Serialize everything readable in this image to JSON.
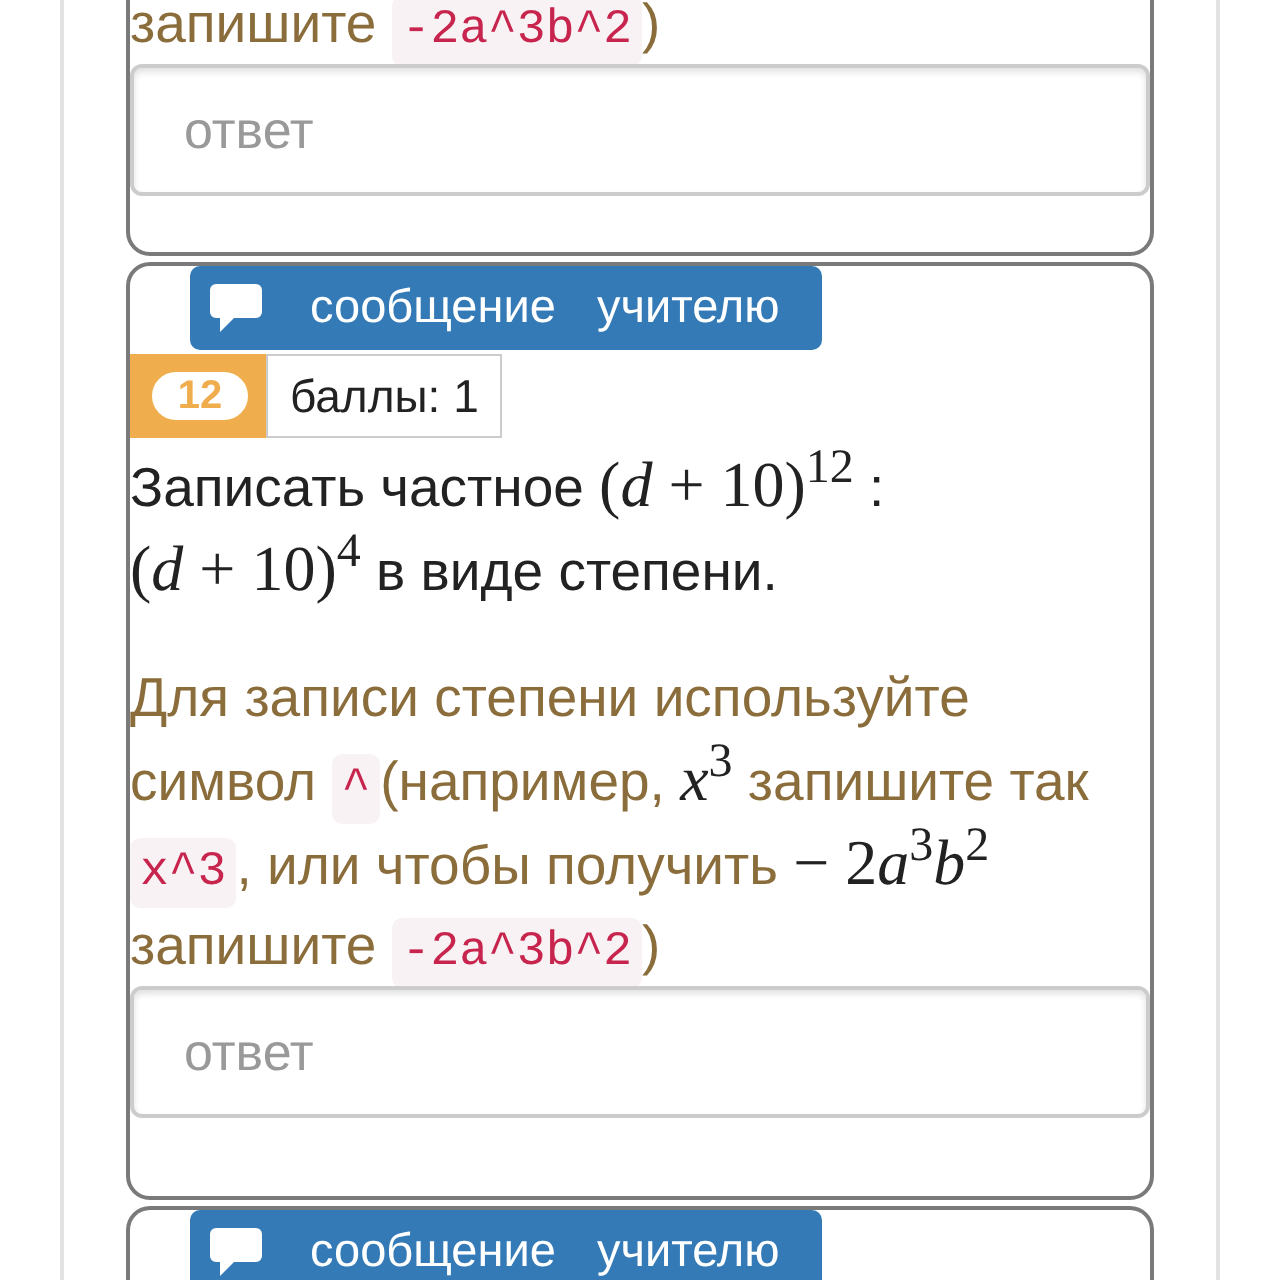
{
  "cards": [
    {
      "hint": [
        {
          "kind": "text",
          "text": "запишите "
        },
        {
          "kind": "code",
          "text": "-2a^3b^2"
        },
        {
          "kind": "text",
          "text": ")"
        }
      ],
      "answer": {
        "placeholder": "ответ"
      }
    },
    {
      "message_button": "сообщение учителю",
      "number": "12",
      "points": "баллы: 1",
      "question": [
        {
          "kind": "text",
          "text": "Записать частное "
        },
        {
          "kind": "math",
          "text": "(*d* + 10)$^{12}$"
        },
        {
          "kind": "text",
          "text": " : "
        },
        {
          "kind": "math",
          "text": "(*d* + 10)$^{4}$"
        },
        {
          "kind": "text",
          "text": " в виде степени."
        }
      ],
      "hint": [
        {
          "kind": "text",
          "text": "Для записи степени используйте символ "
        },
        {
          "kind": "code",
          "text": "^"
        },
        {
          "kind": "text",
          "text": "(например, "
        },
        {
          "kind": "math",
          "text": "*x*$^{3}$"
        },
        {
          "kind": "text",
          "text": " запишите так "
        },
        {
          "kind": "code",
          "text": "x^3"
        },
        {
          "kind": "text",
          "text": ", или чтобы получить "
        },
        {
          "kind": "math",
          "text": "− 2"
        },
        {
          "kind": "math",
          "text": "*a*$^{3}$*b*$^{2}$"
        },
        {
          "kind": "text",
          "text": " запишите "
        },
        {
          "kind": "code",
          "text": "-2a^3b^2"
        },
        {
          "kind": "text",
          "text": ")"
        }
      ],
      "answer": {
        "placeholder": "ответ"
      }
    },
    {
      "message_button": "сообщение учителю"
    }
  ]
}
